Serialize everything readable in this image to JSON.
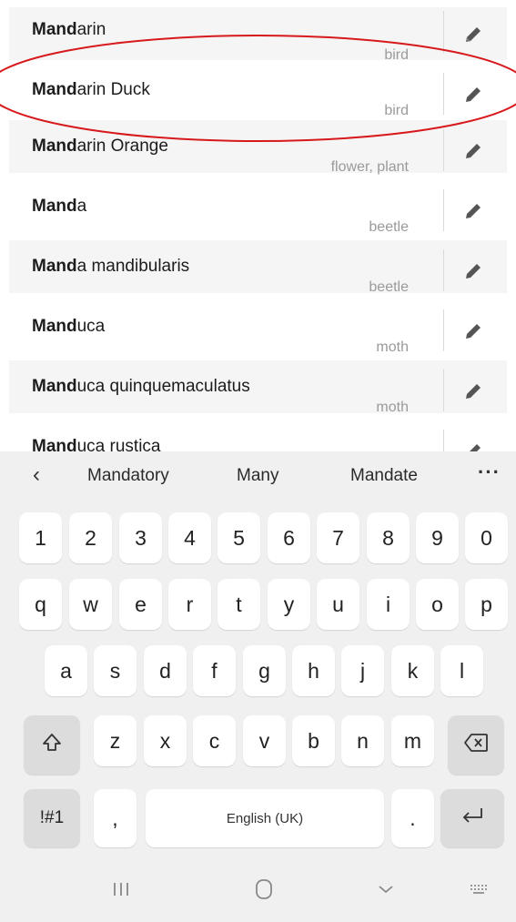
{
  "results": [
    {
      "match": "Mand",
      "rest": "arin",
      "category": "bird"
    },
    {
      "match": "Mand",
      "rest": "arin Duck",
      "category": "bird"
    },
    {
      "match": "Mand",
      "rest": "arin Orange",
      "category": "flower, plant"
    },
    {
      "match": "Mand",
      "rest": "a",
      "category": "beetle"
    },
    {
      "match": "Mand",
      "rest": "a mandibularis",
      "category": "beetle"
    },
    {
      "match": "Mand",
      "rest": "uca",
      "category": "moth"
    },
    {
      "match": "Mand",
      "rest": "uca quinquemaculatus",
      "category": "moth"
    },
    {
      "match": "Mand",
      "rest": "uca rustica",
      "category": ""
    }
  ],
  "edit_icon": "pencil-icon",
  "highlight_color": "#d7191c",
  "keyboard": {
    "suggestions": [
      "Mandatory",
      "Many",
      "Mandate"
    ],
    "digits": [
      "1",
      "2",
      "3",
      "4",
      "5",
      "6",
      "7",
      "8",
      "9",
      "0"
    ],
    "row1": [
      "q",
      "w",
      "e",
      "r",
      "t",
      "y",
      "u",
      "i",
      "o",
      "p"
    ],
    "row2": [
      "a",
      "s",
      "d",
      "f",
      "g",
      "h",
      "j",
      "k",
      "l"
    ],
    "row3": [
      "z",
      "x",
      "c",
      "v",
      "b",
      "n",
      "m"
    ],
    "symbols_label": "!#1",
    "comma": ",",
    "space_label": "English (UK)",
    "period": "."
  }
}
